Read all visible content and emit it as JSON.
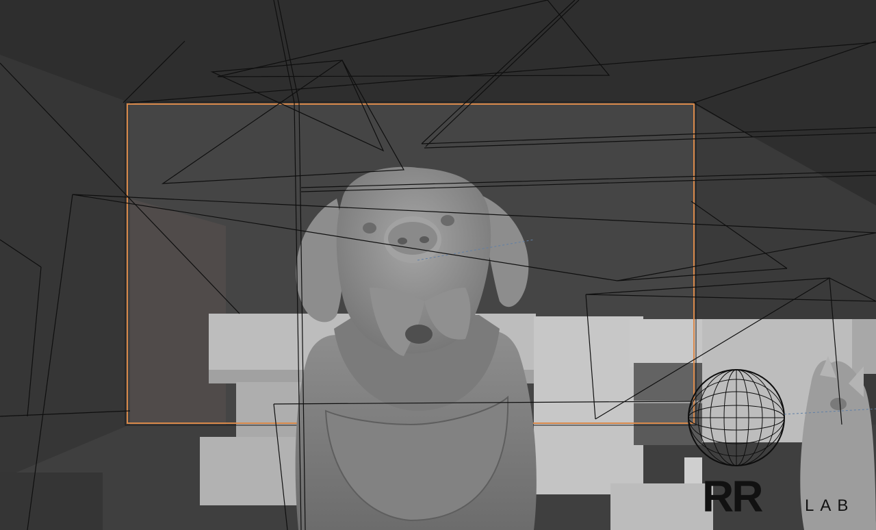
{
  "viewport": {
    "background": "#3b3b3b",
    "wall_color": "#2d2d2d",
    "floor_color": "#a4a4a4",
    "camera_frame_color": "#e0904a",
    "wireframe_color": "#0e0e0e"
  },
  "scene_objects": {
    "main_model": "st-bernard-dog-sculpt",
    "secondary_model": "cat-sculpt",
    "light_gizmo": "sphere-light-wireframe"
  },
  "watermark": {
    "primary": "RR",
    "secondary": "LAB"
  }
}
